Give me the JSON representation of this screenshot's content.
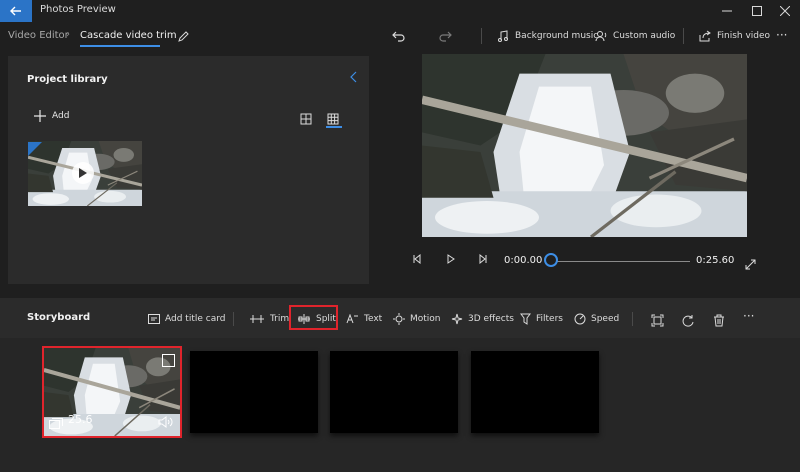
{
  "window": {
    "title": "Photos Preview",
    "controls": [
      "minimize-icon",
      "maximize-icon",
      "close-icon"
    ]
  },
  "breadcrumb": {
    "root": "Video Editor",
    "current": "Cascade video trim"
  },
  "toolbar": {
    "background_music": "Background music",
    "custom_audio": "Custom audio",
    "finish_video": "Finish video"
  },
  "library": {
    "title": "Project library",
    "add_label": "Add"
  },
  "playback": {
    "current_time": "0:00.00",
    "total_time": "0:25.60",
    "progress": 0
  },
  "storyboard": {
    "title": "Storyboard",
    "add_title_card": "Add title card",
    "trim": "Trim",
    "split": "Split",
    "text": "Text",
    "motion": "Motion",
    "effects_3d": "3D effects",
    "filters": "Filters",
    "speed": "Speed",
    "clips": [
      {
        "duration": "25.6",
        "has_media": true
      },
      {
        "has_media": false
      },
      {
        "has_media": false
      },
      {
        "has_media": false
      }
    ]
  },
  "colors": {
    "accent": "#3d8ee6",
    "highlight": "#e0242c",
    "background": "#1f1f1f",
    "panel": "#2b2b2b"
  }
}
